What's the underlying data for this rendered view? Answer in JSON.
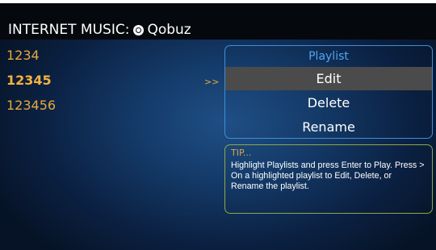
{
  "header": {
    "title": "INTERNET MUSIC:",
    "service_icon": "qobuz-logo-icon",
    "service_name": "Qobuz"
  },
  "playlists": [
    {
      "label": "1234",
      "selected": false
    },
    {
      "label": "12345",
      "selected": true
    },
    {
      "label": "123456",
      "selected": false
    }
  ],
  "selection_arrow": ">>",
  "menu": {
    "title": "Playlist",
    "items": [
      "Edit",
      "Delete",
      "Rename"
    ],
    "highlighted": "Edit"
  },
  "tip": {
    "title": "TIP...",
    "body": "Highlight Playlists and press Enter to Play. Press > On a highlighted playlist to Edit, Delete, or Rename the playlist."
  },
  "colors": {
    "accent_orange": "#e7a93c",
    "menu_border": "#3f8ed8",
    "tip_border": "#8ea84a",
    "highlight_bg": "#4b4b4b"
  }
}
